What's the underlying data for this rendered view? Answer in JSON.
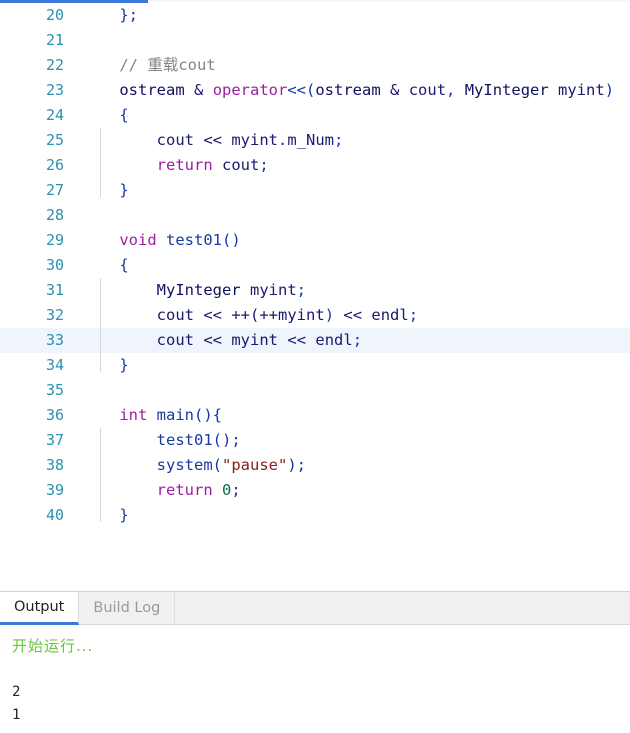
{
  "window": {
    "title": "C++ editor with output console"
  },
  "editor": {
    "first_line_number": 20,
    "highlighted_line": 33,
    "lines": [
      {
        "n": 20,
        "tokens": [
          {
            "t": "    ",
            "c": "ident"
          },
          {
            "t": "};",
            "c": "punct"
          }
        ]
      },
      {
        "n": 21,
        "tokens": []
      },
      {
        "n": 22,
        "tokens": [
          {
            "t": "    ",
            "c": "ident"
          },
          {
            "t": "// 重载cout",
            "c": "com"
          }
        ]
      },
      {
        "n": 23,
        "tokens": [
          {
            "t": "    ",
            "c": "ident"
          },
          {
            "t": "ostream",
            "c": "type"
          },
          {
            "t": " ",
            "c": "ident"
          },
          {
            "t": "&",
            "c": "op"
          },
          {
            "t": " ",
            "c": "ident"
          },
          {
            "t": "operator",
            "c": "kw"
          },
          {
            "t": "<<(",
            "c": "punct"
          },
          {
            "t": "ostream",
            "c": "type"
          },
          {
            "t": " ",
            "c": "ident"
          },
          {
            "t": "&",
            "c": "op"
          },
          {
            "t": " ",
            "c": "ident"
          },
          {
            "t": "cout",
            "c": "ident"
          },
          {
            "t": ", ",
            "c": "punct"
          },
          {
            "t": "MyInteger",
            "c": "type"
          },
          {
            "t": " ",
            "c": "ident"
          },
          {
            "t": "myint",
            "c": "ident"
          },
          {
            "t": ")",
            "c": "punct"
          }
        ]
      },
      {
        "n": 24,
        "tokens": [
          {
            "t": "    ",
            "c": "ident"
          },
          {
            "t": "{",
            "c": "punct"
          }
        ]
      },
      {
        "n": 25,
        "tokens": [
          {
            "t": "        ",
            "c": "ident"
          },
          {
            "t": "cout",
            "c": "ident"
          },
          {
            "t": " ",
            "c": "ident"
          },
          {
            "t": "<<",
            "c": "op"
          },
          {
            "t": " ",
            "c": "ident"
          },
          {
            "t": "myint",
            "c": "ident"
          },
          {
            "t": ".",
            "c": "punct"
          },
          {
            "t": "m_Num",
            "c": "member"
          },
          {
            "t": ";",
            "c": "punct"
          }
        ]
      },
      {
        "n": 26,
        "tokens": [
          {
            "t": "        ",
            "c": "ident"
          },
          {
            "t": "return",
            "c": "kw"
          },
          {
            "t": " ",
            "c": "ident"
          },
          {
            "t": "cout",
            "c": "ident"
          },
          {
            "t": ";",
            "c": "punct"
          }
        ]
      },
      {
        "n": 27,
        "tokens": [
          {
            "t": "    ",
            "c": "ident"
          },
          {
            "t": "}",
            "c": "punct"
          }
        ]
      },
      {
        "n": 28,
        "tokens": []
      },
      {
        "n": 29,
        "tokens": [
          {
            "t": "    ",
            "c": "ident"
          },
          {
            "t": "void",
            "c": "kw"
          },
          {
            "t": " ",
            "c": "ident"
          },
          {
            "t": "test01",
            "c": "fn"
          },
          {
            "t": "()",
            "c": "punct"
          }
        ]
      },
      {
        "n": 30,
        "tokens": [
          {
            "t": "    ",
            "c": "ident"
          },
          {
            "t": "{",
            "c": "punct"
          }
        ]
      },
      {
        "n": 31,
        "tokens": [
          {
            "t": "        ",
            "c": "ident"
          },
          {
            "t": "MyInteger",
            "c": "type"
          },
          {
            "t": " ",
            "c": "ident"
          },
          {
            "t": "myint",
            "c": "ident"
          },
          {
            "t": ";",
            "c": "punct"
          }
        ]
      },
      {
        "n": 32,
        "tokens": [
          {
            "t": "        ",
            "c": "ident"
          },
          {
            "t": "cout",
            "c": "ident"
          },
          {
            "t": " ",
            "c": "ident"
          },
          {
            "t": "<<",
            "c": "op"
          },
          {
            "t": " ",
            "c": "ident"
          },
          {
            "t": "++(++",
            "c": "op"
          },
          {
            "t": "myint",
            "c": "ident"
          },
          {
            "t": ")",
            "c": "punct"
          },
          {
            "t": " ",
            "c": "ident"
          },
          {
            "t": "<<",
            "c": "op"
          },
          {
            "t": " ",
            "c": "ident"
          },
          {
            "t": "endl",
            "c": "ident"
          },
          {
            "t": ";",
            "c": "punct"
          }
        ]
      },
      {
        "n": 33,
        "tokens": [
          {
            "t": "        ",
            "c": "ident"
          },
          {
            "t": "cout",
            "c": "ident"
          },
          {
            "t": " ",
            "c": "ident"
          },
          {
            "t": "<<",
            "c": "op"
          },
          {
            "t": " ",
            "c": "ident"
          },
          {
            "t": "myint",
            "c": "ident"
          },
          {
            "t": " ",
            "c": "ident"
          },
          {
            "t": "<<",
            "c": "op"
          },
          {
            "t": " ",
            "c": "ident"
          },
          {
            "t": "endl",
            "c": "ident"
          },
          {
            "t": ";",
            "c": "punct"
          }
        ]
      },
      {
        "n": 34,
        "tokens": [
          {
            "t": "    ",
            "c": "ident"
          },
          {
            "t": "}",
            "c": "punct"
          }
        ]
      },
      {
        "n": 35,
        "tokens": []
      },
      {
        "n": 36,
        "tokens": [
          {
            "t": "    ",
            "c": "ident"
          },
          {
            "t": "int",
            "c": "kw"
          },
          {
            "t": " ",
            "c": "ident"
          },
          {
            "t": "main",
            "c": "fn"
          },
          {
            "t": "(){",
            "c": "punct"
          }
        ]
      },
      {
        "n": 37,
        "tokens": [
          {
            "t": "        ",
            "c": "ident"
          },
          {
            "t": "test01",
            "c": "fn"
          },
          {
            "t": "();",
            "c": "punct"
          }
        ]
      },
      {
        "n": 38,
        "tokens": [
          {
            "t": "        ",
            "c": "ident"
          },
          {
            "t": "system",
            "c": "fn"
          },
          {
            "t": "(",
            "c": "punct"
          },
          {
            "t": "\"pause\"",
            "c": "str"
          },
          {
            "t": ");",
            "c": "punct"
          }
        ]
      },
      {
        "n": 39,
        "tokens": [
          {
            "t": "        ",
            "c": "ident"
          },
          {
            "t": "return",
            "c": "kw"
          },
          {
            "t": " ",
            "c": "ident"
          },
          {
            "t": "0",
            "c": "num"
          },
          {
            "t": ";",
            "c": "punct"
          }
        ]
      },
      {
        "n": 40,
        "tokens": [
          {
            "t": "    ",
            "c": "ident"
          },
          {
            "t": "}",
            "c": "punct"
          }
        ]
      }
    ]
  },
  "bottom_panel": {
    "tabs": [
      {
        "label": "Output",
        "active": true
      },
      {
        "label": "Build Log",
        "active": false
      }
    ],
    "console": {
      "run_message": "开始运行...",
      "output_lines": [
        "",
        "2",
        "1"
      ]
    }
  },
  "colors": {
    "accent_blue": "#3b78d8",
    "line_number": "#2b91af",
    "keyword_purple": "#9b1fa0",
    "string_red": "#8b1a1a",
    "number_green": "#0e6b52",
    "comment_gray": "#858585",
    "highlight_line": "#f0f4fd",
    "run_message_green": "#62c93b",
    "tabbar_background": "#f0f0f0"
  }
}
